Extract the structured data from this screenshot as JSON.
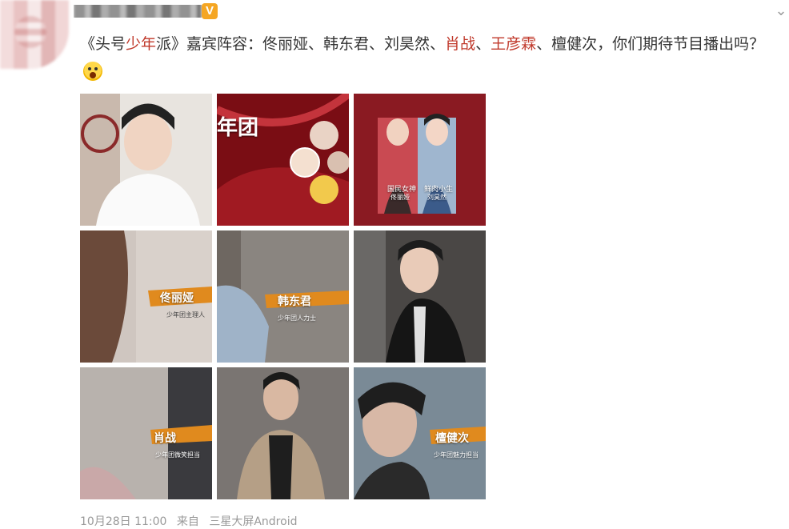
{
  "header": {
    "username": "",
    "verified_badge": "V"
  },
  "post": {
    "segments": [
      {
        "text": "《头号",
        "highlight": false
      },
      {
        "text": "少年",
        "highlight": true
      },
      {
        "text": "派》嘉宾阵容：佟丽娅、韩东君、刘昊然、",
        "highlight": false
      },
      {
        "text": "肖战",
        "highlight": true
      },
      {
        "text": "、",
        "highlight": false
      },
      {
        "text": "王彦霖",
        "highlight": true
      },
      {
        "text": "、檀健次，你们期待节目播出吗？",
        "highlight": false
      }
    ],
    "emoji": "scream-emoji"
  },
  "images": [
    {
      "caption": "",
      "theme": "portrait-white"
    },
    {
      "caption": "年团",
      "theme": "red-poster"
    },
    {
      "caption": "国民女神",
      "sub": "佟丽娅",
      "caption2": "鲜肉小生",
      "sub2": "刘昊然",
      "theme": "red-lineup"
    },
    {
      "caption": "佟丽娅",
      "desc": "少年团主理人",
      "theme": "character-female"
    },
    {
      "caption": "韩东君",
      "desc": "少年团人力士",
      "theme": "character-male"
    },
    {
      "caption": "",
      "theme": "leather-jacket"
    },
    {
      "caption": "肖战",
      "desc": "少年团微笑担当",
      "theme": "character-xz"
    },
    {
      "caption": "",
      "theme": "grey-suit"
    },
    {
      "caption": "檀健次",
      "desc": "少年团魅力担当",
      "theme": "character-tjc"
    }
  ],
  "footer": {
    "date": "10月28日 11:00",
    "source_prefix": "来自",
    "source": "三星大屏Android"
  },
  "colors": {
    "highlight": "#c0392b",
    "text": "#333333",
    "meta": "#999999",
    "badge": "#f5a623"
  }
}
